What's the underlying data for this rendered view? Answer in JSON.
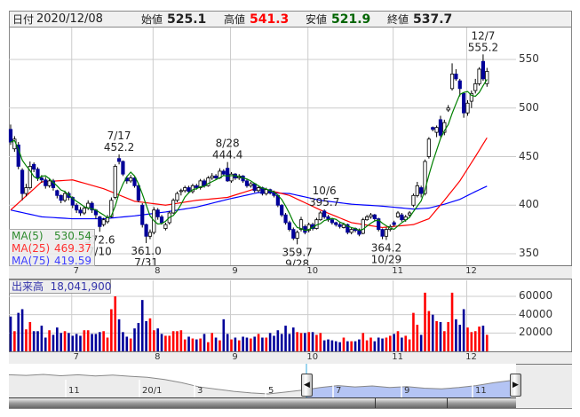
{
  "header": {
    "date_label": "日付",
    "date": "2020/12/08",
    "open_label": "始値",
    "open": "525.1",
    "high_label": "高値",
    "high": "541.3",
    "low_label": "安値",
    "low": "521.9",
    "close_label": "終値",
    "close": "537.7"
  },
  "legend": {
    "ma5_label": "MA(5)",
    "ma5": "530.54",
    "ma25_label": "MA(25)",
    "ma25": "469.37",
    "ma75_label": "MA(75)",
    "ma75": "419.59"
  },
  "volume_legend": {
    "label": "出来高",
    "value": "18,041,900"
  },
  "colors": {
    "up_volume": "#ff0000",
    "down_volume": "#000099",
    "candle_down": "#000099",
    "ma5": "#008000",
    "ma25": "#ff0000",
    "ma75": "#0000ff",
    "high_value": "#ff0000",
    "low_value": "#006400"
  },
  "chart_data": {
    "type": "candlestick",
    "title": "",
    "ylim": [
      340,
      580
    ],
    "yticks": [
      350,
      400,
      450,
      500,
      550
    ],
    "month_labels": [
      "7",
      "8",
      "9",
      "10",
      "11",
      "12"
    ],
    "month_start_index": [
      16,
      37,
      57,
      77,
      99,
      118
    ],
    "candles": [
      [
        478,
        483,
        462,
        465
      ],
      [
        458,
        471,
        455,
        468
      ],
      [
        462,
        465,
        437,
        440
      ],
      [
        436,
        438,
        405,
        412
      ],
      [
        412,
        422,
        409,
        418
      ],
      [
        418,
        445,
        416,
        440
      ],
      [
        442,
        444,
        434,
        437
      ],
      [
        437,
        439,
        425,
        428
      ],
      [
        428,
        431,
        423,
        426
      ],
      [
        426,
        429,
        417,
        420
      ],
      [
        420,
        428,
        418,
        425
      ],
      [
        425,
        427,
        415,
        418
      ],
      [
        415,
        416,
        407,
        410
      ],
      [
        410,
        411,
        402,
        405
      ],
      [
        405,
        415,
        403,
        412
      ],
      [
        412,
        414,
        405,
        408
      ],
      [
        408,
        409,
        397,
        400
      ],
      [
        400,
        402,
        392,
        395
      ],
      [
        395,
        398,
        389,
        392
      ],
      [
        392,
        399,
        390,
        397
      ],
      [
        397,
        405,
        395,
        402
      ],
      [
        402,
        404,
        392,
        395
      ],
      [
        395,
        396,
        386,
        390
      ],
      [
        388,
        389,
        372.6,
        378
      ],
      [
        380,
        387,
        378,
        385
      ],
      [
        383,
        390,
        381,
        387
      ],
      [
        388,
        408,
        387,
        405
      ],
      [
        408,
        442,
        406,
        440
      ],
      [
        448,
        452.2,
        442,
        445
      ],
      [
        445,
        446,
        430,
        432
      ],
      [
        428,
        430,
        422,
        425
      ],
      [
        425,
        431,
        423,
        428
      ],
      [
        428,
        429,
        418,
        420
      ],
      [
        420,
        422,
        403,
        405
      ],
      [
        400,
        402,
        377,
        380
      ],
      [
        380,
        381,
        361.0,
        368
      ],
      [
        368,
        375,
        365,
        372
      ],
      [
        372,
        398,
        370,
        395
      ],
      [
        395,
        397,
        385,
        388
      ],
      [
        388,
        390,
        380,
        382
      ],
      [
        376,
        382,
        374,
        380
      ],
      [
        382,
        394,
        380,
        392
      ],
      [
        392,
        407,
        391,
        405
      ],
      [
        405,
        414,
        403,
        412
      ],
      [
        414,
        417,
        410,
        415
      ],
      [
        415,
        420,
        413,
        418
      ],
      [
        418,
        420,
        412,
        414
      ],
      [
        414,
        422,
        412,
        420
      ],
      [
        420,
        422,
        416,
        418
      ],
      [
        418,
        427,
        416,
        425
      ],
      [
        425,
        427,
        418,
        420
      ],
      [
        420,
        430,
        419,
        428
      ],
      [
        428,
        433,
        426,
        430
      ],
      [
        430,
        432,
        426,
        428
      ],
      [
        428,
        438,
        427,
        435
      ],
      [
        435,
        437,
        430,
        432
      ],
      [
        438,
        444.4,
        424,
        425
      ],
      [
        425,
        434,
        423,
        432
      ],
      [
        432,
        433,
        426,
        428
      ],
      [
        428,
        432,
        426,
        430
      ],
      [
        430,
        431,
        423,
        425
      ],
      [
        425,
        427,
        418,
        420
      ],
      [
        420,
        424,
        418,
        422
      ],
      [
        422,
        423,
        413,
        415
      ],
      [
        415,
        420,
        413,
        418
      ],
      [
        418,
        419,
        410,
        412
      ],
      [
        412,
        418,
        410,
        416
      ],
      [
        416,
        417,
        411,
        413
      ],
      [
        413,
        415,
        408,
        410
      ],
      [
        410,
        411,
        398,
        400
      ],
      [
        400,
        401,
        388,
        390
      ],
      [
        390,
        392,
        380,
        382
      ],
      [
        382,
        384,
        373,
        375
      ],
      [
        375,
        377,
        364,
        366
      ],
      [
        366,
        374,
        359.7,
        372
      ],
      [
        375,
        388,
        373,
        385
      ],
      [
        378,
        380,
        370,
        372
      ],
      [
        374,
        382,
        372,
        380
      ],
      [
        380,
        382,
        374,
        376
      ],
      [
        376,
        387,
        375,
        385
      ],
      [
        385,
        394,
        384,
        392
      ],
      [
        394,
        395.7,
        386,
        388
      ],
      [
        388,
        390,
        383,
        385
      ],
      [
        385,
        387,
        380,
        382
      ],
      [
        382,
        383,
        378,
        380
      ],
      [
        380,
        382,
        376,
        378
      ],
      [
        377,
        382,
        376,
        380
      ],
      [
        380,
        381,
        370,
        372
      ],
      [
        372,
        377,
        370,
        375
      ],
      [
        376,
        377,
        372,
        374
      ],
      [
        374,
        376,
        368,
        370
      ],
      [
        371,
        387,
        370,
        385
      ],
      [
        385,
        390,
        384,
        388
      ],
      [
        388,
        392,
        386,
        390
      ],
      [
        390,
        391,
        384,
        386
      ],
      [
        386,
        387,
        373,
        375
      ],
      [
        375,
        376,
        365,
        368
      ],
      [
        368,
        377,
        364.2,
        375
      ],
      [
        375,
        380,
        373,
        378
      ],
      [
        382,
        384,
        378,
        380
      ],
      [
        388,
        394,
        387,
        392
      ],
      [
        390,
        392,
        383,
        385
      ],
      [
        385,
        390,
        383,
        388
      ],
      [
        390,
        394,
        388,
        392
      ],
      [
        400,
        412,
        398,
        410
      ],
      [
        410,
        424,
        408,
        420
      ],
      [
        418,
        420,
        408,
        412
      ],
      [
        412,
        447,
        410,
        445
      ],
      [
        450,
        470,
        448,
        468
      ],
      [
        480,
        481,
        476,
        478
      ],
      [
        475,
        482,
        470,
        480
      ],
      [
        488,
        492,
        470,
        472
      ],
      [
        475,
        488,
        472,
        485
      ],
      [
        498,
        503,
        496,
        500
      ],
      [
        520,
        546,
        518,
        535
      ],
      [
        535,
        540,
        528,
        530
      ],
      [
        528,
        530,
        512,
        520
      ],
      [
        515,
        516,
        490,
        495
      ],
      [
        495,
        508,
        492,
        505
      ],
      [
        507,
        518,
        500,
        515
      ],
      [
        518,
        530,
        515,
        525
      ],
      [
        525,
        542,
        523,
        540
      ],
      [
        548,
        555.2,
        528,
        530
      ],
      [
        525.1,
        541.3,
        521.9,
        537.7
      ]
    ],
    "ma25_samples": [
      [
        0,
        395
      ],
      [
        8,
        424
      ],
      [
        16,
        426
      ],
      [
        24,
        417
      ],
      [
        32,
        404
      ],
      [
        40,
        400
      ],
      [
        48,
        405
      ],
      [
        56,
        408
      ],
      [
        64,
        418
      ],
      [
        72,
        410
      ],
      [
        80,
        395
      ],
      [
        88,
        382
      ],
      [
        96,
        377
      ],
      [
        104,
        380
      ],
      [
        108,
        386
      ],
      [
        112,
        405
      ],
      [
        116,
        425
      ],
      [
        120,
        450
      ],
      [
        123,
        469.37
      ]
    ],
    "ma75_samples": [
      [
        0,
        395
      ],
      [
        8,
        388
      ],
      [
        16,
        386
      ],
      [
        24,
        386
      ],
      [
        32,
        389
      ],
      [
        40,
        393
      ],
      [
        48,
        398
      ],
      [
        56,
        406
      ],
      [
        64,
        413
      ],
      [
        72,
        412
      ],
      [
        80,
        405
      ],
      [
        88,
        401
      ],
      [
        96,
        399
      ],
      [
        104,
        396
      ],
      [
        108,
        397
      ],
      [
        112,
        401
      ],
      [
        116,
        406
      ],
      [
        120,
        414
      ],
      [
        123,
        419.59
      ]
    ],
    "annotations": [
      {
        "index": 28,
        "type": "high",
        "date": "7/17",
        "value": "452.2"
      },
      {
        "index": 23,
        "type": "low",
        "date": "7/10",
        "value": "372.6"
      },
      {
        "index": 35,
        "type": "low",
        "date": "7/31",
        "value": "361.0"
      },
      {
        "index": 56,
        "type": "high",
        "date": "8/28",
        "value": "444.4"
      },
      {
        "index": 74,
        "type": "low",
        "date": "9/28",
        "value": "359.7"
      },
      {
        "index": 81,
        "type": "high",
        "date": "10/6",
        "value": "395.7"
      },
      {
        "index": 97,
        "type": "low",
        "date": "10/29",
        "value": "364.2"
      },
      {
        "index": 122,
        "type": "high",
        "date": "12/7",
        "value": "555.2"
      }
    ],
    "volume": {
      "ylim": [
        0,
        66000
      ],
      "yticks": [
        "20000",
        "40000",
        "60000"
      ],
      "values_thousands": [
        38,
        22,
        42,
        46,
        24,
        32,
        22,
        22,
        28,
        15,
        23,
        18,
        26,
        20,
        22,
        20,
        17,
        19,
        17,
        23,
        23,
        19,
        19,
        21,
        22,
        15,
        46,
        60,
        35,
        21,
        16,
        14,
        25,
        31,
        56,
        33,
        36,
        23,
        25,
        19,
        17,
        17,
        22,
        22,
        23,
        13,
        16,
        14,
        13,
        14,
        19,
        10,
        20,
        15,
        12,
        35,
        19,
        13,
        15,
        12,
        16,
        15,
        14,
        16,
        19,
        15,
        15,
        20,
        17,
        23,
        19,
        28,
        19,
        26,
        21,
        20,
        20,
        21,
        21,
        18,
        20,
        12,
        13,
        12,
        11,
        10,
        15,
        11,
        11,
        11,
        13,
        20,
        12,
        15,
        11,
        15,
        14,
        15,
        17,
        19,
        22,
        15,
        17,
        13,
        42,
        29,
        18,
        64,
        44,
        40,
        33,
        32,
        22,
        32,
        64,
        35,
        29,
        46,
        26,
        21,
        22,
        27,
        28,
        18
      ]
    }
  },
  "navigator": {
    "labels": [
      "11",
      "20/1",
      "3",
      "5",
      "7",
      "9",
      "11"
    ],
    "series": [
      600,
      598,
      601,
      597,
      600,
      596,
      599,
      595,
      592,
      585,
      575,
      562,
      555,
      548,
      543,
      540,
      546,
      552,
      560,
      566,
      562,
      565,
      560,
      563,
      558,
      556,
      560,
      566,
      575,
      582
    ]
  }
}
